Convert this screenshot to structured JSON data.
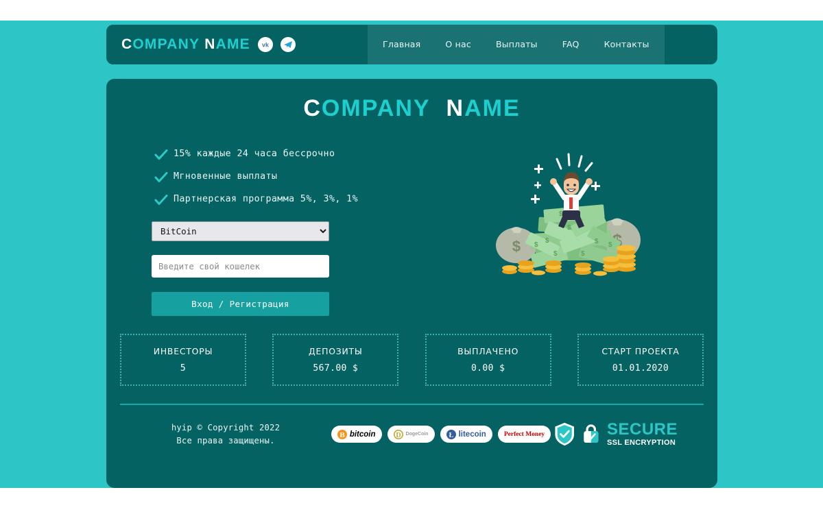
{
  "site": {
    "brand_cap": "C",
    "brand_rest_1": "OMPANY",
    "brand_cap2": "N",
    "brand_rest_2": "AME",
    "accent_color": "#1dd0d0",
    "card_color": "#046262",
    "page_color": "#2dc6c6"
  },
  "header": {
    "social": [
      {
        "name": "vk-icon",
        "label": "VK"
      },
      {
        "name": "telegram-icon",
        "label": "Telegram"
      }
    ],
    "nav": [
      {
        "label": "Главная",
        "active": true
      },
      {
        "label": "О нас",
        "active": false
      },
      {
        "label": "Выплаты",
        "active": false
      },
      {
        "label": "FAQ",
        "active": false
      },
      {
        "label": "Контакты",
        "active": false
      }
    ]
  },
  "hero": {
    "title_cap1": "C",
    "title_rest1": "OMPANY",
    "title_cap2": "N",
    "title_rest2": "AME",
    "features": [
      "15% каждые 24 часа бессрочно",
      "Мгновенные выплаты",
      "Партнерская программа 5%, 3%, 1%"
    ],
    "form": {
      "currency_selected": "BitCoin",
      "currency_options": [
        "BitCoin"
      ],
      "wallet_placeholder": "Введите свой кошелек",
      "wallet_value": "",
      "submit_label": "Вход / Регистрация"
    },
    "illustration": "man-sitting-on-money-pile"
  },
  "stats": [
    {
      "label": "ИНВЕСТОРЫ",
      "value": "5"
    },
    {
      "label": "ДЕПОЗИТЫ",
      "value": "567.00 $"
    },
    {
      "label": "ВЫПЛАЧЕНО",
      "value": "0.00 $"
    },
    {
      "label": "СТАРТ ПРОЕКТА",
      "value": "01.01.2020"
    }
  ],
  "footer": {
    "copyright_line1": "hyip © Copyright 2022",
    "copyright_line2": "Все права защищены.",
    "payments": [
      {
        "name": "bitcoin",
        "label": "bitcoin",
        "color": "#f7931a"
      },
      {
        "name": "dogecoin",
        "label": "DogeCoin",
        "color": "#c2a633"
      },
      {
        "name": "litecoin",
        "label": "litecoin",
        "color": "#345d9d"
      },
      {
        "name": "perfect-money",
        "label": "Perfect Money",
        "color": "#cc0000"
      }
    ],
    "ssl": {
      "main": "SECURE",
      "sub": "SSL ENCRYPTION"
    }
  }
}
